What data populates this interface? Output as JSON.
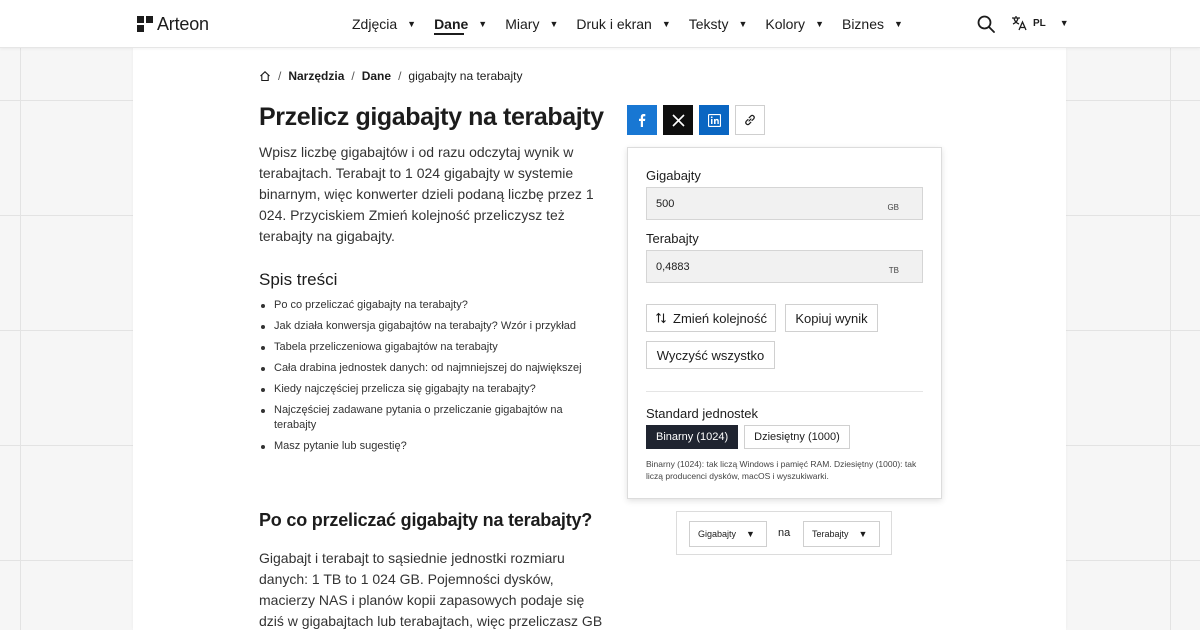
{
  "brand": {
    "name": "Arteon"
  },
  "nav": {
    "items": [
      {
        "label": "Zdjęcia",
        "active": false
      },
      {
        "label": "Dane",
        "active": true
      },
      {
        "label": "Miary",
        "active": false
      },
      {
        "label": "Druk i ekran",
        "active": false
      },
      {
        "label": "Teksty",
        "active": false
      },
      {
        "label": "Kolory",
        "active": false
      },
      {
        "label": "Biznes",
        "active": false
      }
    ],
    "search_icon": "search-icon",
    "language": {
      "icon": "translate-icon",
      "label": "PL"
    }
  },
  "breadcrumb": {
    "home_icon": "home-icon",
    "items": [
      "Narzędzia",
      "Dane",
      "gigabajty na terabajty"
    ]
  },
  "page": {
    "title": "Przelicz gigabajty na terabajty",
    "intro": "Wpisz liczbę gigabajtów i od razu odczytaj wynik w terabajtach. Terabajt to 1 024 gigabajty w systemie binarnym, więc konwerter dzieli podaną liczbę przez 1 024. Przyciskiem Zmień kolejność przeliczysz też terabajty na gigabajty.",
    "toc_title": "Spis treści",
    "toc": [
      "Po co przeliczać gigabajty na terabajty?",
      "Jak działa konwersja gigabajtów na terabajty? Wzór i przykład",
      "Tabela przeliczeniowa gigabajtów na terabajty",
      "Cała drabina jednostek danych: od najmniejszej do największej",
      "Kiedy najczęściej przelicza się gigabajty na terabajty?",
      "Najczęściej zadawane pytania o przeliczanie gigabajtów na terabajty",
      "Masz pytanie lub sugestię?"
    ],
    "section_title": "Po co przeliczać gigabajty na terabajty?",
    "section_body": "Gigabajt i terabajt to sąsiednie jednostki rozmiaru danych: 1 TB to 1 024 GB. Pojemności dysków, macierzy NAS i planów kopii zapasowych podaje się dziś w gigabajtach lub terabajtach, więc przeliczasz GB na TB, gdy chcesz"
  },
  "share": {
    "icons": [
      "facebook-icon",
      "x-icon",
      "linkedin-icon",
      "link-icon"
    ],
    "colors": {
      "facebook": "#1877d3",
      "x": "#0e0e0e",
      "linkedin": "#0a66c2"
    }
  },
  "converter": {
    "from": {
      "label": "Gigabajty",
      "value": "500",
      "unit": "GB"
    },
    "to": {
      "label": "Terabajty",
      "value": "0,4883",
      "unit": "TB"
    },
    "swap_label": "Zmień kolejność",
    "copy_label": "Kopiuj wynik",
    "clear_label": "Wyczyść wszystko",
    "standard": {
      "label": "Standard jednostek",
      "options": [
        "Binarny (1024)",
        "Dziesiętny (1000)"
      ],
      "selected": "Binarny (1024)",
      "note": "Binarny (1024): tak liczą Windows i pamięć RAM. Dziesiętny (1000): tak liczą producenci dysków, macOS i wyszukiwarki."
    }
  },
  "unit_switch": {
    "from_unit": "Gigabajty",
    "connector": "na",
    "to_unit": "Terabajty"
  }
}
